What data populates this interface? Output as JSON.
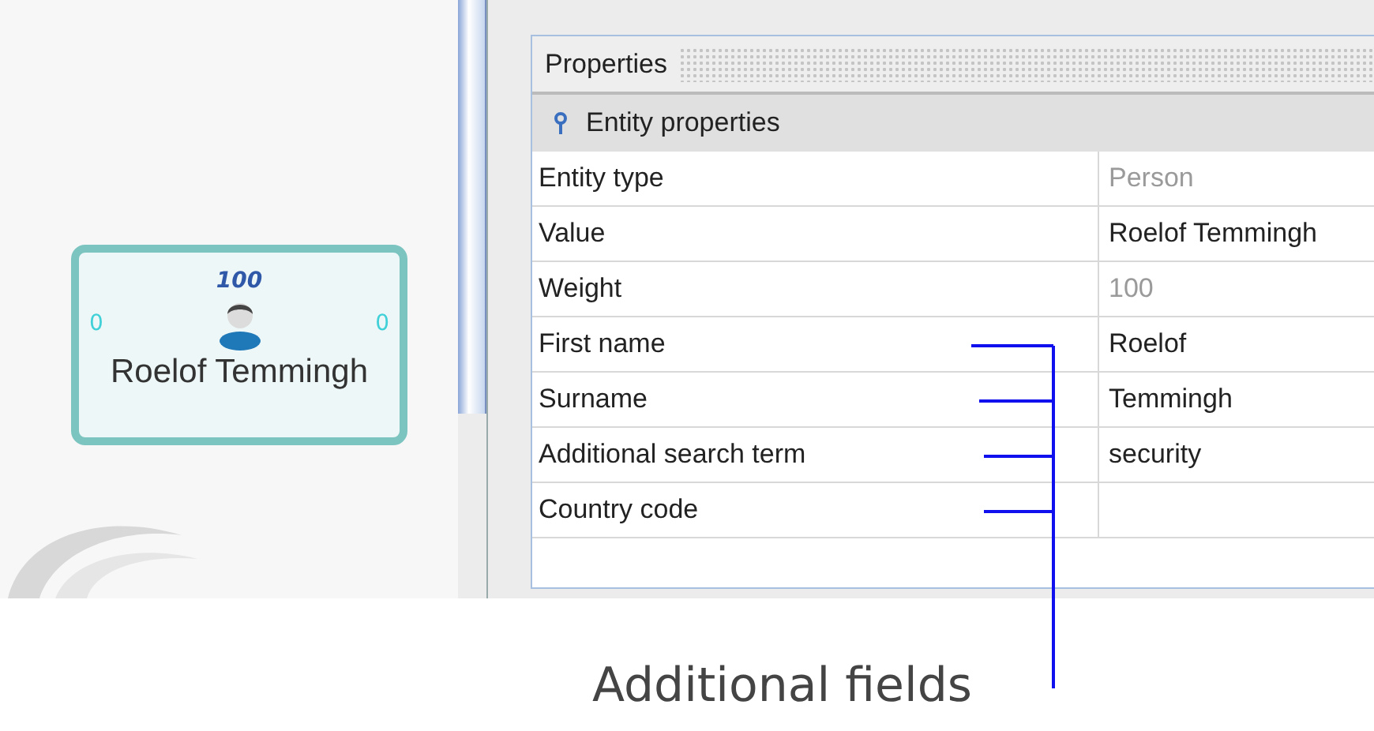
{
  "graph": {
    "node": {
      "weight": "100",
      "incoming": "0",
      "outgoing": "0",
      "label": "Roelof Temmingh"
    }
  },
  "properties": {
    "title": "Properties",
    "section": "Entity properties",
    "rows": [
      {
        "label": "Entity type",
        "value": "Person",
        "disabled": true,
        "annotated": false
      },
      {
        "label": "Value",
        "value": "Roelof Temmingh",
        "disabled": false,
        "annotated": false
      },
      {
        "label": "Weight",
        "value": "100",
        "disabled": true,
        "annotated": false
      },
      {
        "label": "First name",
        "value": "Roelof",
        "disabled": false,
        "annotated": true
      },
      {
        "label": "Surname",
        "value": "Temmingh",
        "disabled": false,
        "annotated": true
      },
      {
        "label": "Additional search term",
        "value": "security",
        "disabled": false,
        "annotated": true
      },
      {
        "label": "Country code",
        "annotated": true
      }
    ]
  },
  "annotation": {
    "text": "Additional fields"
  }
}
